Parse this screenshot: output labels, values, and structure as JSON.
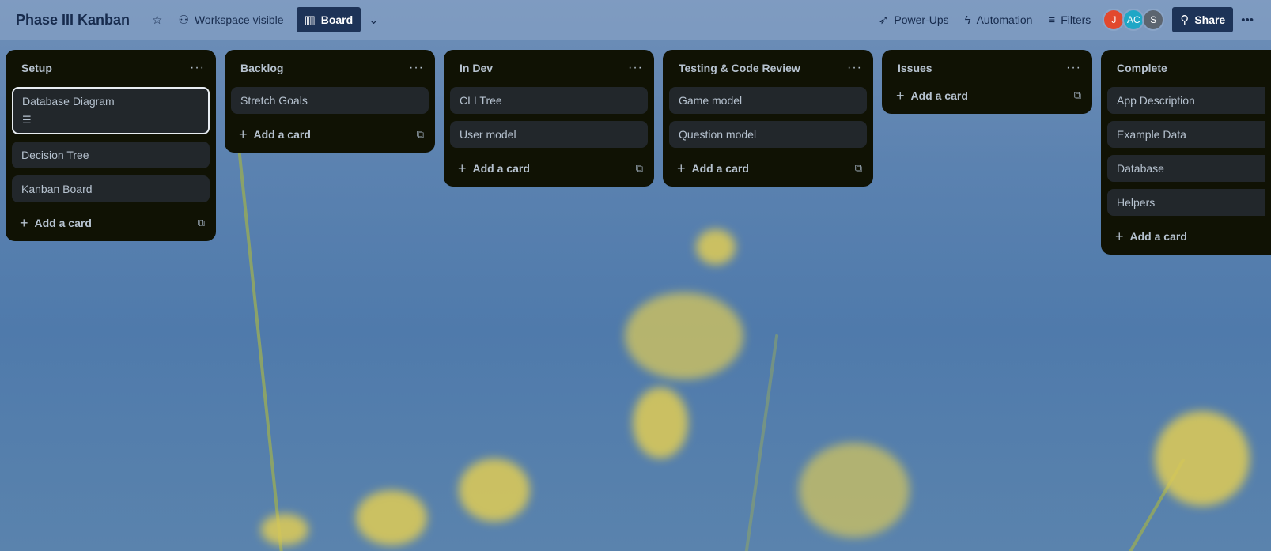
{
  "header": {
    "board_title": "Phase III Kanban",
    "visibility_label": "Workspace visible",
    "view_label": "Board",
    "powerups_label": "Power-Ups",
    "automation_label": "Automation",
    "filters_label": "Filters",
    "share_label": "Share",
    "members": [
      {
        "initials": "J",
        "color": "#e2482d"
      },
      {
        "initials": "AC",
        "color": "#1fa7c6"
      },
      {
        "initials": "S",
        "color": "#5c6570"
      }
    ]
  },
  "lists": [
    {
      "title": "Setup",
      "cards": [
        "Database Diagram",
        "Decision Tree",
        "Kanban Board"
      ],
      "add_label": "Add a card"
    },
    {
      "title": "Backlog",
      "cards": [
        "Stretch Goals"
      ],
      "add_label": "Add a card"
    },
    {
      "title": "In Dev",
      "cards": [
        "CLI Tree",
        "User model"
      ],
      "add_label": "Add a card"
    },
    {
      "title": "Testing & Code Review",
      "cards": [
        "Game model",
        "Question model"
      ],
      "add_label": "Add a card"
    },
    {
      "title": "Issues",
      "cards": [],
      "add_label": "Add a card"
    },
    {
      "title": "Complete",
      "cards": [
        "App Description",
        "Example Data",
        "Database",
        "Helpers"
      ],
      "add_label": "Add a card"
    }
  ],
  "icons": {
    "star": "star-icon",
    "visibility": "people-icon",
    "board": "board-icon",
    "chevron": "chevron-down-icon",
    "powerups": "rocket-icon",
    "automation": "lightning-icon",
    "filters": "filter-icon",
    "share": "add-person-icon",
    "more": "more-icon"
  },
  "colors": {
    "list_bg": "#101204",
    "card_bg": "#22272b",
    "header_button": "#1d3357"
  }
}
